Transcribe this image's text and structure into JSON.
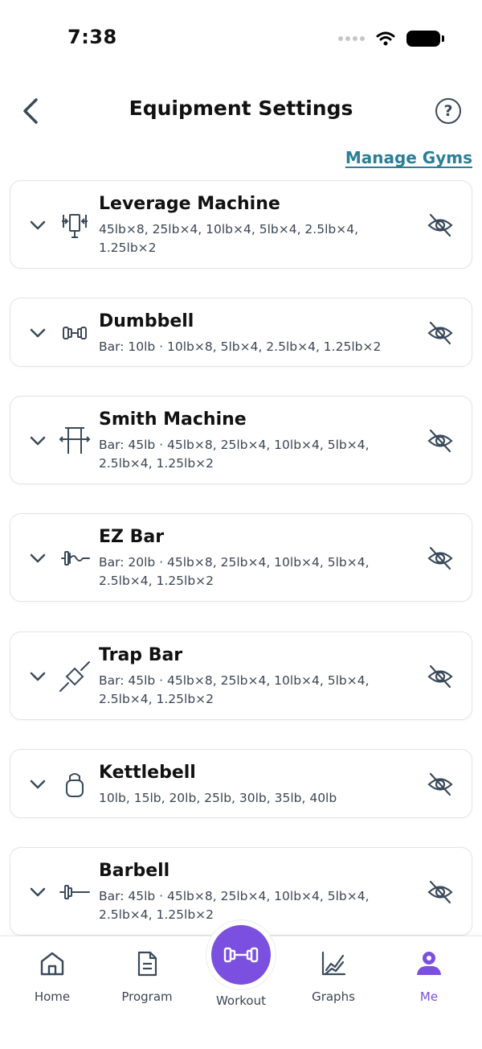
{
  "status_bar": {
    "time": "7:38"
  },
  "header": {
    "title": "Equipment Settings",
    "help_label": "?"
  },
  "manage_gyms_label": "Manage Gyms",
  "equipment": [
    {
      "name": "Leverage Machine",
      "details": "45lb×8, 25lb×4, 10lb×4, 5lb×4, 2.5lb×4, 1.25lb×2",
      "icon": "leverage-machine-icon"
    },
    {
      "name": "Dumbbell",
      "details": "Bar: 10lb · 10lb×8, 5lb×4, 2.5lb×4, 1.25lb×2",
      "icon": "dumbbell-icon"
    },
    {
      "name": "Smith Machine",
      "details": "Bar: 45lb · 45lb×8, 25lb×4, 10lb×4, 5lb×4, 2.5lb×4, 1.25lb×2",
      "icon": "smith-machine-icon"
    },
    {
      "name": "EZ Bar",
      "details": "Bar: 20lb · 45lb×8, 25lb×4, 10lb×4, 5lb×4, 2.5lb×4, 1.25lb×2",
      "icon": "ez-bar-icon"
    },
    {
      "name": "Trap Bar",
      "details": "Bar: 45lb · 45lb×8, 25lb×4, 10lb×4, 5lb×4, 2.5lb×4, 1.25lb×2",
      "icon": "trap-bar-icon"
    },
    {
      "name": "Kettlebell",
      "details": "10lb, 15lb, 20lb, 25lb, 30lb, 35lb, 40lb",
      "icon": "kettlebell-icon"
    },
    {
      "name": "Barbell",
      "details": "Bar: 45lb · 45lb×8, 25lb×4, 10lb×4, 5lb×4, 2.5lb×4, 1.25lb×2",
      "icon": "barbell-icon"
    }
  ],
  "tabs": [
    {
      "label": "Home",
      "icon": "home-icon"
    },
    {
      "label": "Program",
      "icon": "document-icon"
    },
    {
      "label": "Workout",
      "icon": "dumbbell-icon"
    },
    {
      "label": "Graphs",
      "icon": "graph-icon"
    },
    {
      "label": "Me",
      "icon": "user-icon",
      "active": true
    }
  ],
  "colors": {
    "accent": "#7b4fe0",
    "link": "#2b7f96",
    "icon_stroke": "#3a4a5a"
  }
}
